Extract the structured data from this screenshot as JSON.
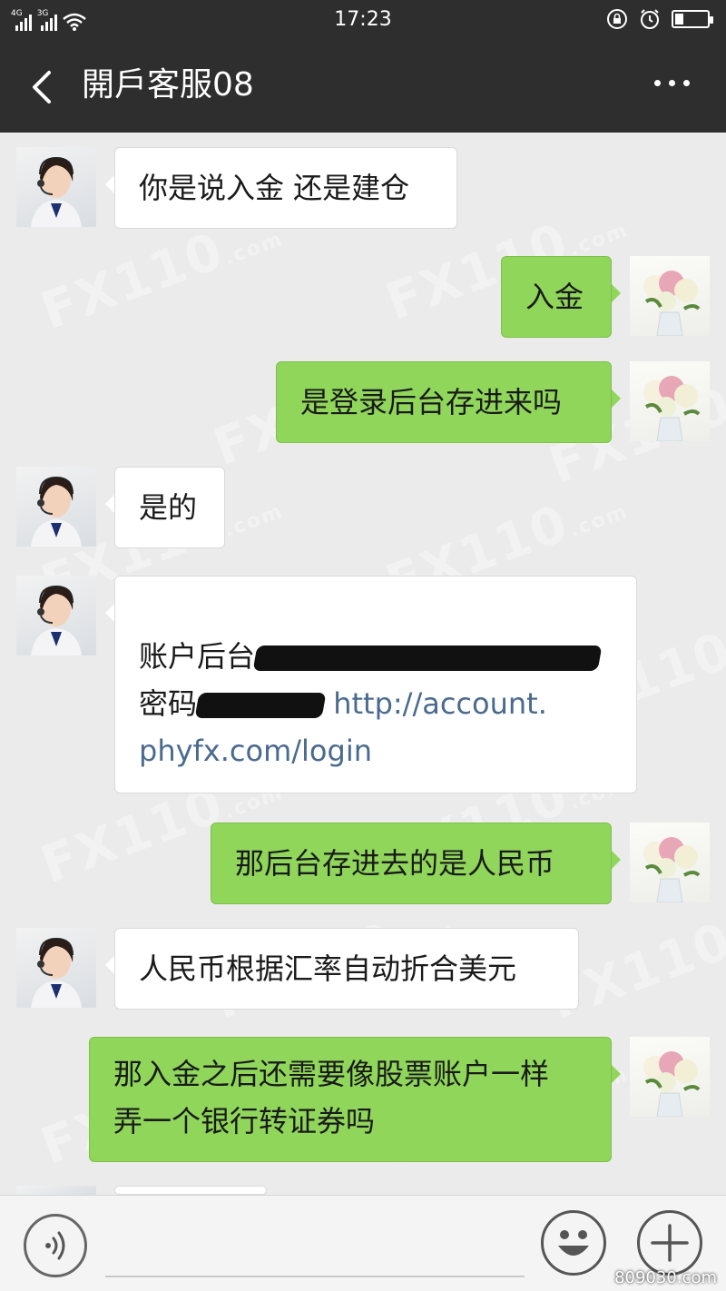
{
  "status_bar": {
    "signal_1_label": "4G",
    "signal_2_label": "3G",
    "time": "17:23",
    "icons": [
      "signal-4g-icon",
      "signal-3g-icon",
      "wifi-icon",
      "rotation-lock-icon",
      "alarm-icon",
      "battery-icon"
    ],
    "battery_level": 0.25
  },
  "header": {
    "title": "開戶客服08",
    "back_icon": "chevron-left-icon",
    "menu_icon": "more-dots-icon"
  },
  "messages": [
    {
      "from": "agent",
      "text": "你是说入金 还是建仓"
    },
    {
      "from": "me",
      "text": "入金"
    },
    {
      "from": "me",
      "text": "是登录后台存进来吗"
    },
    {
      "from": "agent",
      "text": "是的"
    },
    {
      "from": "agent",
      "line1": "账户后台",
      "line2": "密码",
      "link_part1": "http://account.",
      "link_part2": "phyfx.com/login"
    },
    {
      "from": "me",
      "text": "那后台存进去的是人民币"
    },
    {
      "from": "agent",
      "text": "人民币根据汇率自动折合美元"
    },
    {
      "from": "me",
      "line1": "那入金之后还需要像股票账户一样",
      "line2": "弄一个银行转证券吗"
    }
  ],
  "watermark": {
    "main": "FX110",
    "suffix": ".com"
  },
  "input_bar": {
    "voice_icon": "voice-icon",
    "emoji_icon": "emoji-icon",
    "plus_icon": "plus-icon"
  },
  "site_mark": "809030.com",
  "colors": {
    "header_bg": "#2e2e2e",
    "chat_bg": "#ebebeb",
    "outgoing_bubble": "#8fd65a",
    "incoming_bubble": "#ffffff",
    "link": "#4a6a8e"
  }
}
